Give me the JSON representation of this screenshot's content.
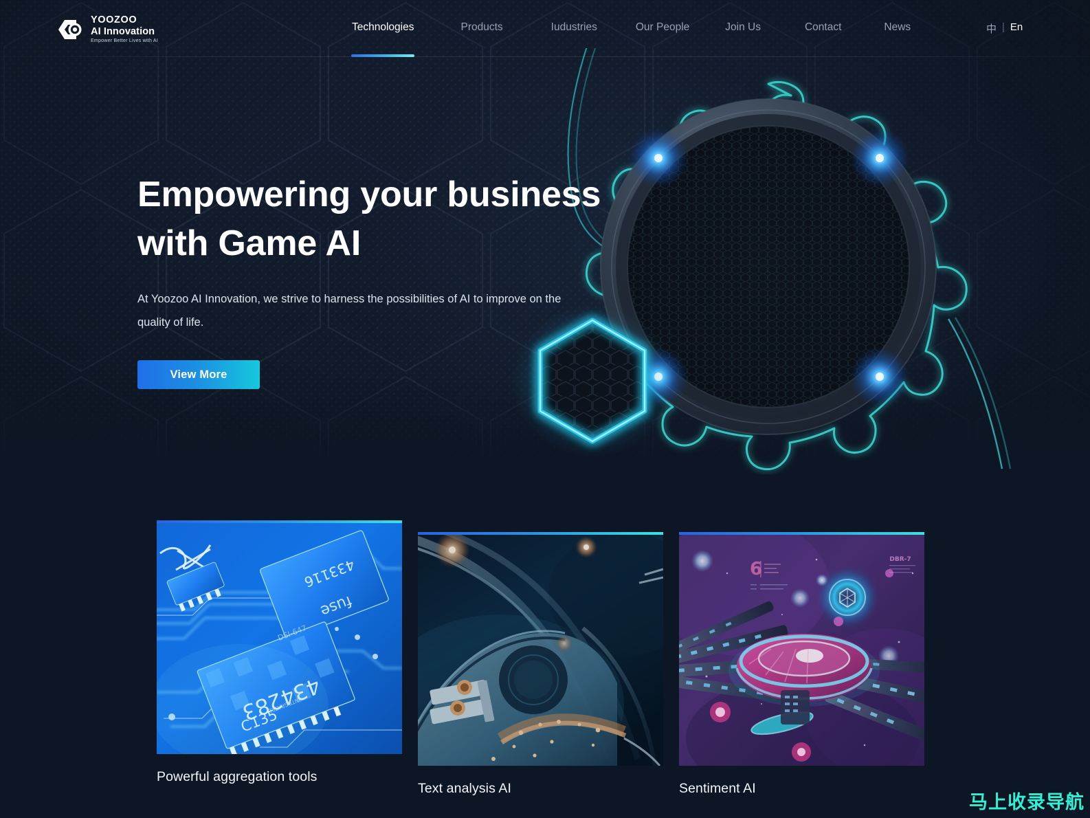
{
  "header": {
    "logo": {
      "icon": "eye-logo-icon",
      "line1": "YOOZOO",
      "line2": "AI Innovation",
      "tagline": "Empower Better Lives with AI"
    },
    "nav": [
      {
        "label": "Technologies",
        "active": true
      },
      {
        "label": "Products",
        "active": false
      },
      {
        "label": "Iudustries",
        "active": false
      },
      {
        "label": "Our People",
        "active": false
      },
      {
        "label": "Join Us",
        "active": false
      },
      {
        "label": "Contact",
        "active": false
      },
      {
        "label": "News",
        "active": false
      }
    ],
    "language": {
      "chinese": "中",
      "separator": "|",
      "english": "En",
      "active": "En"
    }
  },
  "hero": {
    "title_line1": "Empowering your business",
    "title_line2": "with Game AI",
    "subtitle": "At Yoozoo AI Innovation, we strive to harness the possibilities of AI to improve on the quality of life.",
    "cta_label": "View More",
    "art": {
      "gear_icon": "glowing-gear-icon",
      "hexagon_icon": "glowing-hexagon-icon"
    }
  },
  "cards": [
    {
      "title": "Powerful aggregation tools",
      "image": "circuit-board-chip-image"
    },
    {
      "title": "Text analysis AI",
      "image": "abstract-machinery-image"
    },
    {
      "title": "Sentiment AI",
      "image": "sci-fi-spaceship-image"
    }
  ],
  "watermark": {
    "text": "马上收录导航"
  },
  "colors": {
    "background": "#0d1624",
    "hero_background": "#121b2b",
    "accent_blue": "#1f6fe8",
    "accent_cyan": "#16c8dd",
    "glow_teal": "#3fe0e0",
    "nav_inactive": "#96a1b4",
    "nav_active": "#ffffff",
    "watermark": "#2ff0d8"
  }
}
